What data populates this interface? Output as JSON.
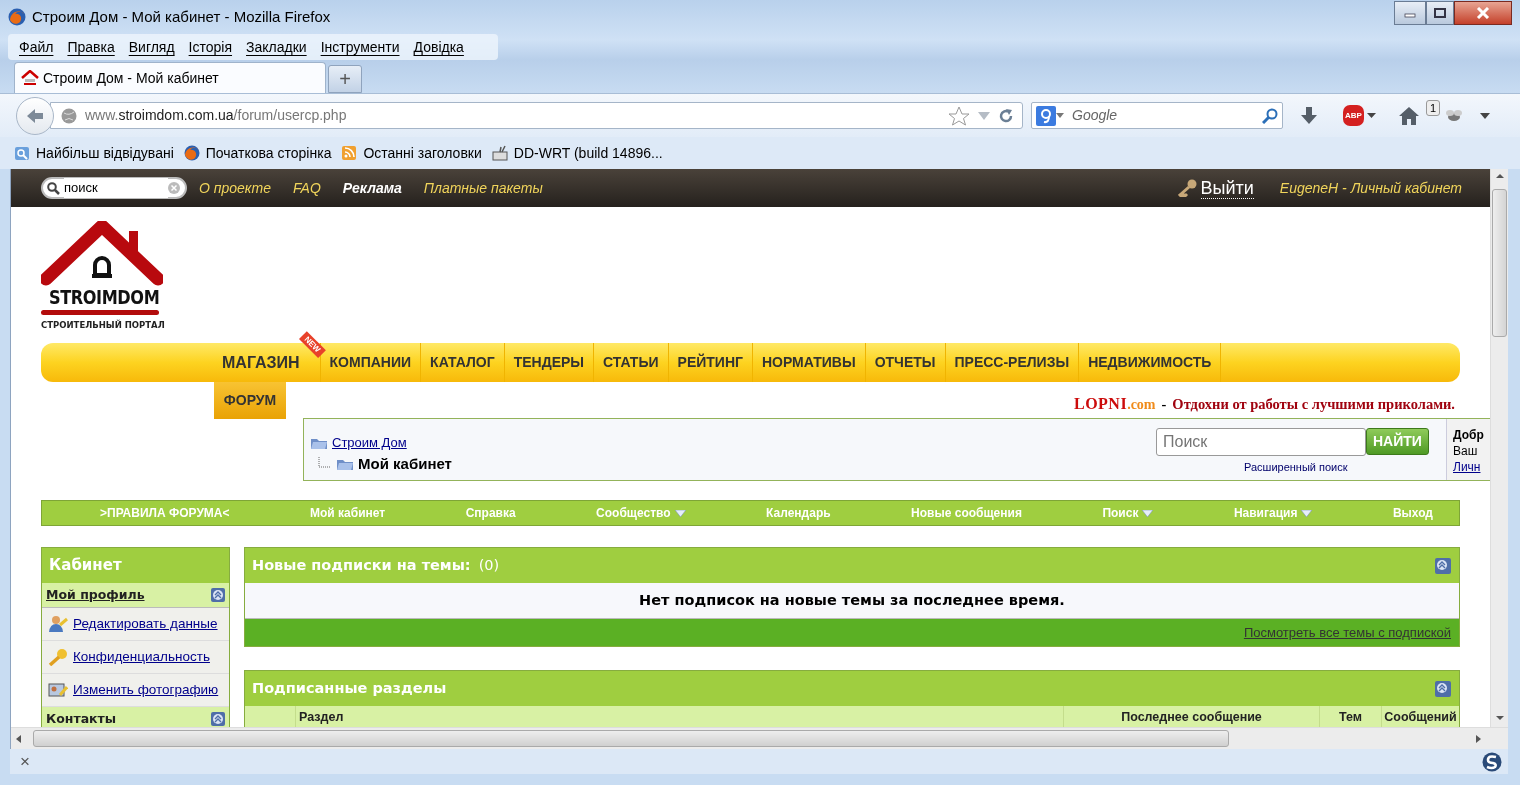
{
  "window": {
    "title": "Строим Дом - Мой кабинет - Mozilla Firefox"
  },
  "menu": [
    {
      "label": "Файл"
    },
    {
      "label": "Правка"
    },
    {
      "label": "Вигляд"
    },
    {
      "label": "Історія"
    },
    {
      "label": "Закладки"
    },
    {
      "label": "Інструменти"
    },
    {
      "label": "Довідка"
    }
  ],
  "tabs": [
    {
      "label": "Строим Дом - Мой кабинет",
      "selected": true
    }
  ],
  "new_tab": "+",
  "address": {
    "prefix": "www.",
    "domain": "stroimdom.com.ua",
    "path": "/forum/usercp.php"
  },
  "browser_search": {
    "placeholder": "Google"
  },
  "toolbar": {
    "adblock": "ABP",
    "badge": "1"
  },
  "bookmarks": [
    {
      "label": "Найбільш відвідувані",
      "kind": "smart"
    },
    {
      "label": "Початкова сторінка",
      "kind": "firefox"
    },
    {
      "label": "Останні заголовки",
      "kind": "rss"
    },
    {
      "label": "DD-WRT (build 14896...",
      "kind": "router"
    }
  ],
  "site": {
    "top_search": {
      "value": "поиск"
    },
    "top_links": [
      {
        "label": "О проекте",
        "bold": false
      },
      {
        "label": "FAQ",
        "bold": false
      },
      {
        "label": "Реклама",
        "bold": true
      },
      {
        "label": "Платные пакеты",
        "bold": false
      }
    ],
    "logout": "Выйти",
    "user_link": "EugeneH - Личный кабинет",
    "logo": {
      "name": "STROIMDOM",
      "tagline": "СТРОИТЕЛЬНЫЙ ПОРТАЛ"
    },
    "main_nav": [
      {
        "label": "МАГАЗИН",
        "ribbon": "NEW"
      },
      {
        "label": "КОМПАНИИ"
      },
      {
        "label": "КАТАЛОГ"
      },
      {
        "label": "ТЕНДЕРЫ"
      },
      {
        "label": "СТАТЬИ"
      },
      {
        "label": "РЕЙТИНГ"
      },
      {
        "label": "НОРМАТИВЫ"
      },
      {
        "label": "ОТЧЕТЫ"
      },
      {
        "label": "ПРЕСС-РЕЛИЗЫ"
      },
      {
        "label": "НЕДВИЖИМОСТЬ"
      }
    ],
    "sub_nav": [
      {
        "label": "ФОРУМ",
        "selected": true
      }
    ],
    "promo": {
      "brand": "LOPNI",
      "brand_suffix": ".com",
      "separator": "-",
      "text": "Отдохни от работы с лучшими приколами."
    },
    "breadcrumb": {
      "root": "Строим Дом",
      "current": "Мой кабинет"
    },
    "forum_search": {
      "placeholder": "Поиск",
      "button": "НАЙТИ",
      "advanced": "Расширенный поиск"
    },
    "welcome": {
      "lines": [
        "Добр",
        "Ваш",
        "Личн"
      ]
    },
    "forum_nav": [
      {
        "label": ">ПРАВИЛА ФОРУМА<",
        "dropdown": false
      },
      {
        "label": "Мой кабинет",
        "dropdown": false
      },
      {
        "label": "Справка",
        "dropdown": false
      },
      {
        "label": "Сообщество",
        "dropdown": true
      },
      {
        "label": "Календарь",
        "dropdown": false
      },
      {
        "label": "Новые сообщения",
        "dropdown": false
      },
      {
        "label": "Поиск",
        "dropdown": true
      },
      {
        "label": "Навигация",
        "dropdown": true
      },
      {
        "label": "Выход",
        "dropdown": false
      }
    ],
    "sidebar": {
      "title": "Кабинет",
      "sections": [
        {
          "title": "Мой профиль",
          "link": true,
          "items": [
            {
              "label": "Редактировать данные",
              "kind": "user"
            },
            {
              "label": "Конфиденциальность",
              "kind": "key"
            },
            {
              "label": "Изменить фотографию",
              "kind": "photo"
            }
          ]
        },
        {
          "title": "Контакты",
          "link": false
        }
      ]
    },
    "panels": [
      {
        "title": "Новые подписки на темы:",
        "count": "(0)",
        "message": "Нет подписок на новые темы за последнее время.",
        "footer_link": "Посмотреть все темы с подпиской"
      },
      {
        "title": "Подписанные разделы",
        "columns": [
          "Раздел",
          "Последнее сообщение",
          "Тем",
          "Сообщений"
        ]
      }
    ]
  },
  "status_bar": {
    "close": "×"
  }
}
